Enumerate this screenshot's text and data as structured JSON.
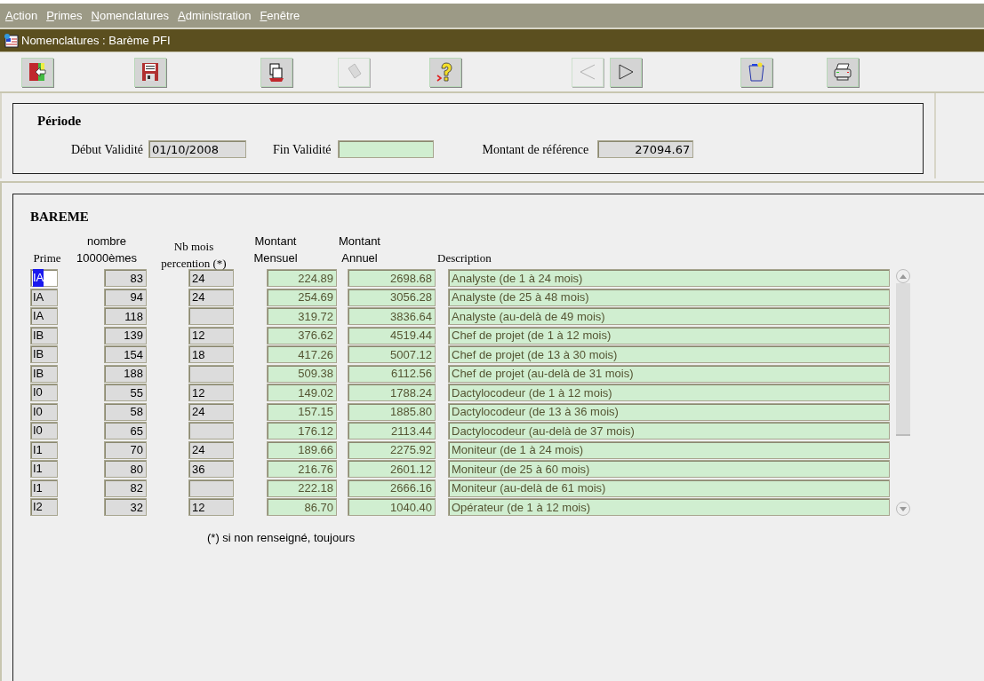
{
  "menu": [
    {
      "label": "Action"
    },
    {
      "label": "Primes"
    },
    {
      "label": "Nomenclatures"
    },
    {
      "label": "Administration"
    },
    {
      "label": "Fenêtre"
    }
  ],
  "window": {
    "title": "Nomenclatures : Barème PFI"
  },
  "toolbar": [
    {
      "kind": "exit",
      "disabled": false
    },
    {
      "kind": "save",
      "disabled": false
    },
    {
      "kind": "document",
      "disabled": false
    },
    {
      "kind": "eraser",
      "disabled": true
    },
    {
      "kind": "help",
      "disabled": false
    },
    {
      "kind": "previous",
      "disabled": true
    },
    {
      "kind": "next",
      "disabled": false
    },
    {
      "kind": "trash",
      "disabled": false
    },
    {
      "kind": "print",
      "disabled": false
    }
  ],
  "periode": {
    "title": "Période",
    "debut_label": "Début Validité",
    "debut_value": "01/10/2008",
    "fin_label": "Fin Validité",
    "reference_label": "Montant de référence",
    "reference_value": "27094.67"
  },
  "bareme": {
    "title": "BAREME",
    "columns": [
      "Prime",
      "nombre\n10000èmes",
      "Nb mois\npercention (*)",
      "Montant\nMensuel",
      "Montant\nAnnuel",
      "Description"
    ],
    "rows": [
      {
        "prime": "IA",
        "nombre": "83",
        "nb_mois": "24",
        "mensuel": "224.89",
        "annuel": "2698.68",
        "description": "Analyste (de 1 à 24 mois)",
        "selected": true
      },
      {
        "prime": "IA",
        "nombre": "94",
        "nb_mois": "24",
        "mensuel": "254.69",
        "annuel": "3056.28",
        "description": "Analyste (de 25 à 48 mois)",
        "selected": false
      },
      {
        "prime": "IA",
        "nombre": "118",
        "mensuel": "319.72",
        "annuel": "3836.64",
        "description": "Analyste (au-delà de 49 mois)",
        "selected": false
      },
      {
        "prime": "IB",
        "nombre": "139",
        "nb_mois": "12",
        "mensuel": "376.62",
        "annuel": "4519.44",
        "description": "Chef de projet (de 1 à 12 mois)",
        "selected": false
      },
      {
        "prime": "IB",
        "nombre": "154",
        "nb_mois": "18",
        "mensuel": "417.26",
        "annuel": "5007.12",
        "description": "Chef de projet (de 13 à 30 mois)",
        "selected": false
      },
      {
        "prime": "IB",
        "nombre": "188",
        "mensuel": "509.38",
        "annuel": "6112.56",
        "description": "Chef de projet (au-delà de 31 mois)",
        "selected": false
      },
      {
        "prime": "I0",
        "nombre": "55",
        "nb_mois": "12",
        "mensuel": "149.02",
        "annuel": "1788.24",
        "description": "Dactylocodeur (de 1 à 12 mois)",
        "selected": false
      },
      {
        "prime": "I0",
        "nombre": "58",
        "nb_mois": "24",
        "mensuel": "157.15",
        "annuel": "1885.80",
        "description": "Dactylocodeur (de 13 à 36 mois)",
        "selected": false
      },
      {
        "prime": "I0",
        "nombre": "65",
        "mensuel": "176.12",
        "annuel": "2113.44",
        "description": "Dactylocodeur (au-delà de 37 mois)",
        "selected": false
      },
      {
        "prime": "I1",
        "nombre": "70",
        "nb_mois": "24",
        "mensuel": "189.66",
        "annuel": "2275.92",
        "description": "Moniteur (de 1 à 24 mois)",
        "selected": false
      },
      {
        "prime": "I1",
        "nombre": "80",
        "nb_mois": "36",
        "mensuel": "216.76",
        "annuel": "2601.12",
        "description": "Moniteur (de 25 à 60 mois)",
        "selected": false
      },
      {
        "prime": "I1",
        "nombre": "82",
        "mensuel": "222.18",
        "annuel": "2666.16",
        "description": "Moniteur (au-delà de 61 mois)",
        "selected": false
      },
      {
        "prime": "I2",
        "nombre": "32",
        "nb_mois": "12",
        "mensuel": "86.70",
        "annuel": "1040.40",
        "description": "Opérateur (de 1 à 12 mois)",
        "selected": false
      }
    ],
    "footnote": "(*) si non renseigné, toujours"
  }
}
